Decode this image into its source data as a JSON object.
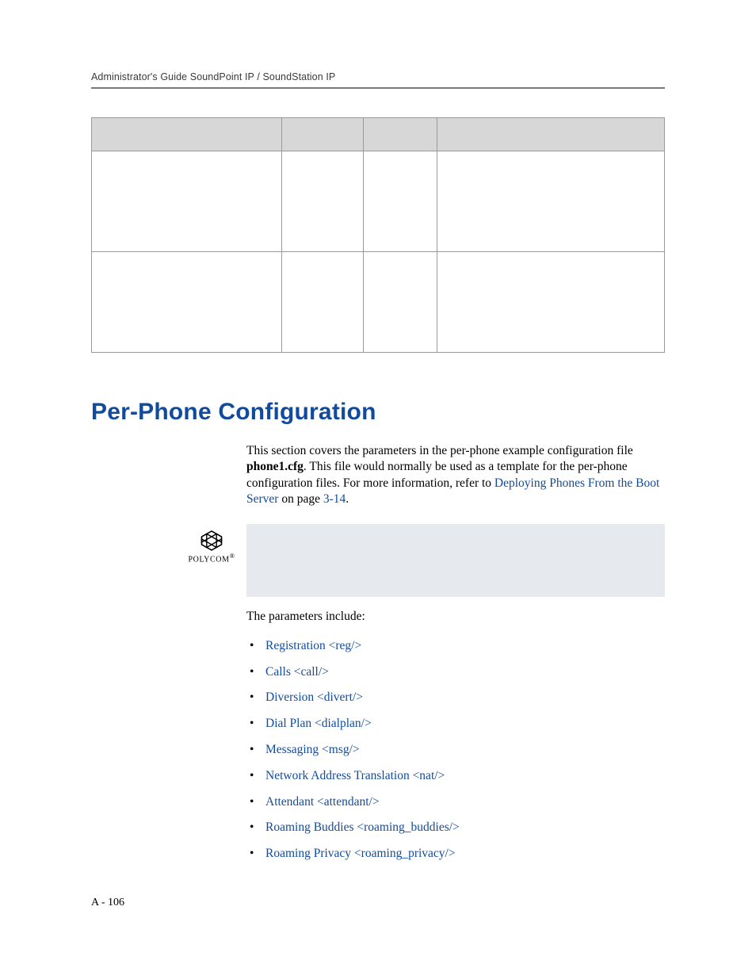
{
  "header": {
    "running": "Administrator's Guide SoundPoint IP / SoundStation IP"
  },
  "section_title": "Per-Phone Configuration",
  "intro": {
    "pre": "This section covers the parameters in the per-phone example configuration file ",
    "bold": "phone1.cfg",
    "mid": ". This file would normally be used as a template for the per-phone configuration files. For more information, refer to ",
    "link1": "Deploying Phones From the Boot Server",
    "after_link": " on page ",
    "pageref": "3-14",
    "end": "."
  },
  "logo_label": "POLYCOM",
  "lead": "The parameters include:",
  "items": [
    "Registration <reg/>",
    "Calls <call/>",
    "Diversion <divert/>",
    "Dial Plan <dialplan/>",
    "Messaging <msg/>",
    "Network Address Translation <nat/>",
    "Attendant <attendant/>",
    "Roaming Buddies <roaming_buddies/>",
    "Roaming Privacy <roaming_privacy/>"
  ],
  "page_number": "A - 106"
}
